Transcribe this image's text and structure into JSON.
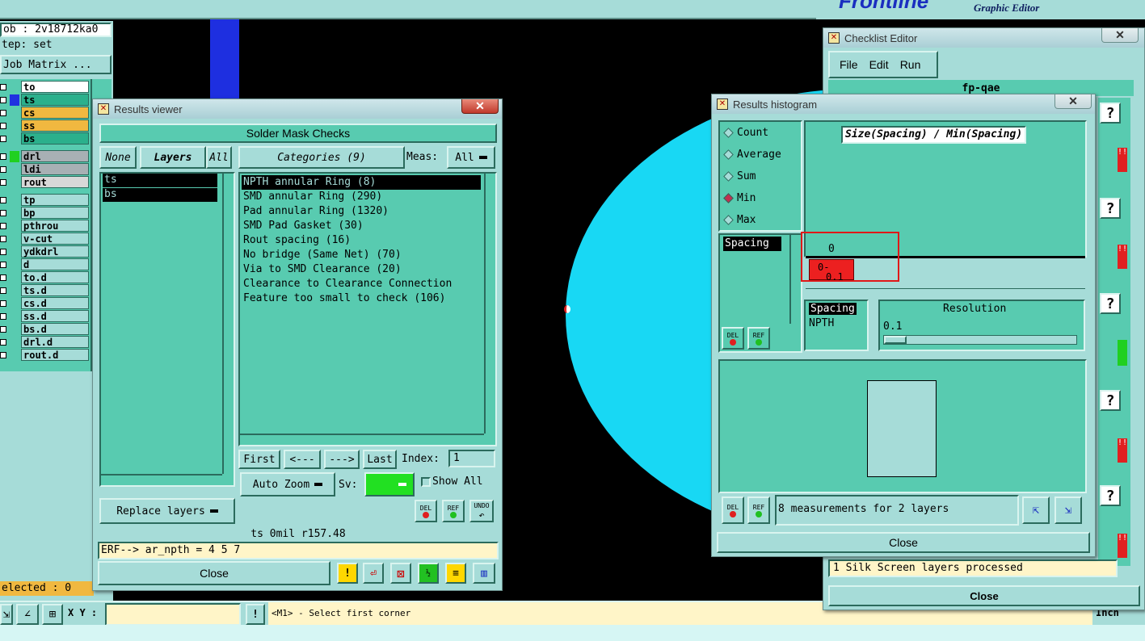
{
  "top_banner": {
    "logo": "Frontline",
    "subtitle": "Graphic Editor"
  },
  "left_panel": {
    "job": "ob : 2v18712ka0",
    "step": "tep: set",
    "job_matrix": "Job Matrix ...",
    "layers": [
      {
        "name": "to",
        "bg": "#ffffff"
      },
      {
        "name": "ts",
        "bg": "#2bb08c"
      },
      {
        "name": "cs",
        "bg": "#f0b840"
      },
      {
        "name": "ss",
        "bg": "#f0b840"
      },
      {
        "name": "bs",
        "bg": "#2bb08c"
      },
      {
        "name": "drl",
        "bg": "#a8b0b4"
      },
      {
        "name": "ldi",
        "bg": "#a8b0b4"
      },
      {
        "name": "rout",
        "bg": "#d8d8d8"
      },
      {
        "name": "tp",
        "bg": "#a6dcd8"
      },
      {
        "name": "bp",
        "bg": "#a6dcd8"
      },
      {
        "name": "pthrou",
        "bg": "#a6dcd8"
      },
      {
        "name": "v-cut",
        "bg": "#a6dcd8"
      },
      {
        "name": "ydkdrl",
        "bg": "#a6dcd8"
      },
      {
        "name": "d",
        "bg": "#a6dcd8"
      },
      {
        "name": "to.d",
        "bg": "#a6dcd8"
      },
      {
        "name": "ts.d",
        "bg": "#a6dcd8"
      },
      {
        "name": "cs.d",
        "bg": "#a6dcd8"
      },
      {
        "name": "ss.d",
        "bg": "#a6dcd8"
      },
      {
        "name": "bs.d",
        "bg": "#a6dcd8"
      },
      {
        "name": "drl.d",
        "bg": "#a6dcd8"
      },
      {
        "name": "rout.d",
        "bg": "#a6dcd8"
      }
    ],
    "selected": "elected : 0"
  },
  "status_bar": {
    "xy_label": "X Y :",
    "xy_value": "",
    "message": "<M1> - Select first corner",
    "units": "Inch"
  },
  "results_viewer": {
    "title": "Results viewer",
    "header": "Solder Mask Checks",
    "none_btn": "None",
    "layers_btn": "Layers",
    "all_btn": "All",
    "layers": [
      "ts",
      "bs"
    ],
    "categories_btn": "Categories (9)",
    "meas_label": "Meas:",
    "meas_value": "All",
    "categories": [
      "NPTH annular Ring (8)",
      "SMD annular Ring (290)",
      "Pad annular Ring (1320)",
      "SMD Pad Gasket (30)",
      "Rout spacing (16)",
      "No bridge (Same Net) (70)",
      "Via to SMD Clearance (20)",
      "Clearance to Clearance Connection",
      "Feature too small to check (106)"
    ],
    "first_btn": "First",
    "prev_btn": "<---",
    "next_btn": "--->",
    "last_btn": "Last",
    "index_label": "Index:",
    "index_value": "1",
    "replace_layers": "Replace layers",
    "auto_zoom": "Auto Zoom",
    "sv_label": "Sv:",
    "show_all": "Show All",
    "del_label": "DEL",
    "ref_label": "REF",
    "undo_label": "UNDO",
    "status_line": "ts 0mil  r157.48",
    "erf_line": "ERF--> ar_npth = 4 5 7",
    "close": "Close"
  },
  "checklist_editor": {
    "title": "Checklist Editor",
    "menu": [
      "File",
      "Edit",
      "Run"
    ],
    "name": "fp-qae",
    "status": "1 Silk Screen layers processed",
    "close": "Close"
  },
  "results_histogram": {
    "title": "Results histogram",
    "radio_options": [
      "Count",
      "Average",
      "Sum",
      "Min",
      "Max"
    ],
    "selected_option": "Min",
    "chart_title": "Size(Spacing) / Min(Spacing)",
    "list_item": "Spacing",
    "bin_count_label": "0",
    "bin_label_top": "0-",
    "bin_label_bottom": "0.1",
    "spacing_label": "Spacing",
    "npth_label": "NPTH",
    "resolution_label": "Resolution",
    "resolution_value": "0.1",
    "measurements": "8 measurements for 2 layers",
    "del_label": "DEL",
    "ref_label": "REF",
    "close": "Close"
  }
}
